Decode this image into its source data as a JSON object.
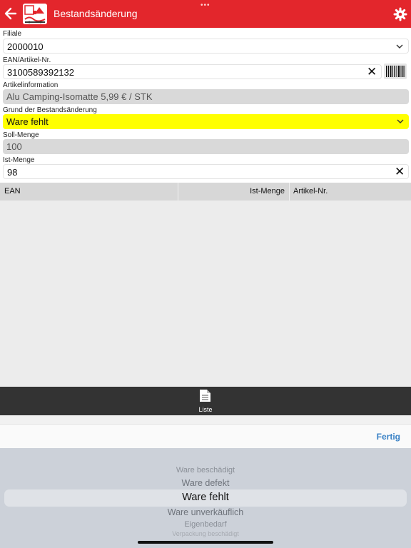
{
  "header": {
    "title": "Bestandsänderung",
    "accent_color": "#e3262c",
    "back_icon": "arrow-left-icon",
    "settings_icon": "gear-icon"
  },
  "form": {
    "filiale": {
      "label": "Filiale",
      "value": "2000010"
    },
    "ean": {
      "label": "EAN/Artikel-Nr.",
      "value": "3100589392132"
    },
    "artikelinfo": {
      "label": "Artikelinformation",
      "value": "Alu Camping-Isomatte 5,99 € / STK"
    },
    "grund": {
      "label": "Grund der Bestandsänderung",
      "value": "Ware fehlt"
    },
    "soll": {
      "label": "Soll-Menge",
      "value": "100"
    },
    "ist": {
      "label": "Ist-Menge",
      "value": "98"
    },
    "clear_glyph": "✕"
  },
  "table": {
    "columns": [
      "EAN",
      "Ist-Menge",
      "Artikel-Nr."
    ],
    "rows": []
  },
  "tabbar": {
    "items": [
      {
        "label": "Liste",
        "icon": "document-list-icon"
      }
    ]
  },
  "toolbar": {
    "done_label": "Fertig"
  },
  "picker": {
    "options": [
      "Ware beschädigt",
      "Ware defekt",
      "Ware fehlt",
      "Ware unverkäuflich",
      "Eigenbedarf",
      "Verpackung beschädigt"
    ],
    "selected": "Ware fehlt"
  }
}
